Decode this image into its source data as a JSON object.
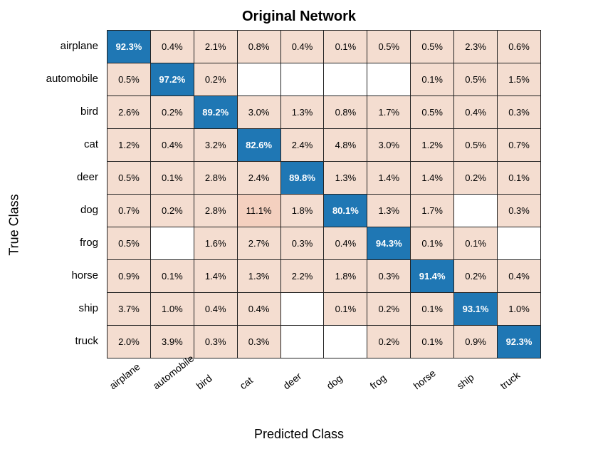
{
  "chart_data": {
    "type": "heatmap",
    "title": "Original Network",
    "xlabel": "Predicted Class",
    "ylabel": "True Class",
    "row_labels": [
      "airplane",
      "automobile",
      "bird",
      "cat",
      "deer",
      "dog",
      "frog",
      "horse",
      "ship",
      "truck"
    ],
    "col_labels": [
      "airplane",
      "automobile",
      "bird",
      "cat",
      "deer",
      "dog",
      "frog",
      "horse",
      "ship",
      "truck"
    ],
    "matrix": [
      [
        "92.3%",
        "0.4%",
        "2.1%",
        "0.8%",
        "0.4%",
        "0.1%",
        "0.5%",
        "0.5%",
        "2.3%",
        "0.6%"
      ],
      [
        "0.5%",
        "97.2%",
        "0.2%",
        "",
        "",
        "",
        "",
        "0.1%",
        "0.5%",
        "1.5%"
      ],
      [
        "2.6%",
        "0.2%",
        "89.2%",
        "3.0%",
        "1.3%",
        "0.8%",
        "1.7%",
        "0.5%",
        "0.4%",
        "0.3%"
      ],
      [
        "1.2%",
        "0.4%",
        "3.2%",
        "82.6%",
        "2.4%",
        "4.8%",
        "3.0%",
        "1.2%",
        "0.5%",
        "0.7%"
      ],
      [
        "0.5%",
        "0.1%",
        "2.8%",
        "2.4%",
        "89.8%",
        "1.3%",
        "1.4%",
        "1.4%",
        "0.2%",
        "0.1%"
      ],
      [
        "0.7%",
        "0.2%",
        "2.8%",
        "11.1%",
        "1.8%",
        "80.1%",
        "1.3%",
        "1.7%",
        "",
        "0.3%"
      ],
      [
        "0.5%",
        "",
        "1.6%",
        "2.7%",
        "0.3%",
        "0.4%",
        "94.3%",
        "0.1%",
        "0.1%",
        ""
      ],
      [
        "0.9%",
        "0.1%",
        "1.4%",
        "1.3%",
        "2.2%",
        "1.8%",
        "0.3%",
        "91.4%",
        "0.2%",
        "0.4%"
      ],
      [
        "3.7%",
        "1.0%",
        "0.4%",
        "0.4%",
        "",
        "0.1%",
        "0.2%",
        "0.1%",
        "93.1%",
        "1.0%"
      ],
      [
        "2.0%",
        "3.9%",
        "0.3%",
        "0.3%",
        "",
        "",
        "0.2%",
        "0.1%",
        "0.9%",
        "92.3%"
      ]
    ],
    "colors": {
      "diagonal_bg": "#1f77b4",
      "diagonal_fg": "#ffffff",
      "off_empty_bg": "#ffffff",
      "off_low_bg": "#f4ddd0",
      "off_mid_bg": "#f4d0bf",
      "off_fg": "#000000"
    }
  }
}
